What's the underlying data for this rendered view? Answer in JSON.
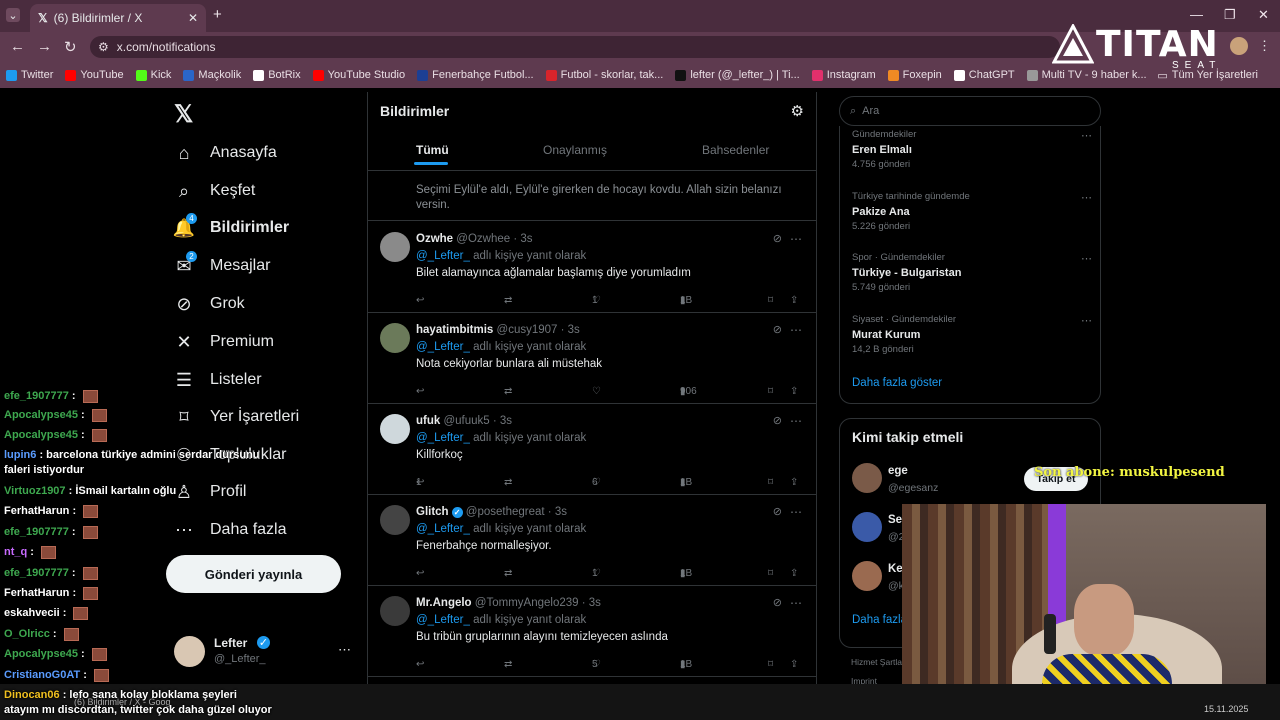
{
  "browser": {
    "tab_title": "(6) Bildirimler / X",
    "url": "x.com/notifications",
    "bookmarks": [
      {
        "label": "Twitter",
        "color": "#1d9bf0"
      },
      {
        "label": "YouTube",
        "color": "#ff0000"
      },
      {
        "label": "Kick",
        "color": "#53fc18"
      },
      {
        "label": "Maçkolik",
        "color": "#2a66c9"
      },
      {
        "label": "BotRix",
        "color": "#ffffff"
      },
      {
        "label": "YouTube Studio",
        "color": "#ff0000"
      },
      {
        "label": "Fenerbahçe Futbol...",
        "color": "#1c3f94"
      },
      {
        "label": "Futbol - skorlar, tak...",
        "color": "#d8242b"
      },
      {
        "label": "lefter (@_lefter_) | Ti...",
        "color": "#111111"
      },
      {
        "label": "Instagram",
        "color": "#e1306c"
      },
      {
        "label": "Foxepin",
        "color": "#f08a24"
      },
      {
        "label": "ChatGPT",
        "color": "#ffffff"
      },
      {
        "label": "Multi TV - 9 haber k...",
        "color": "#999999"
      }
    ],
    "all_bookmarks": "Tüm Yer İşaretleri"
  },
  "brand_overlay": {
    "titan": "TITAN",
    "seat": "SEAT"
  },
  "sidebar": {
    "items": [
      {
        "label": "Anasayfa",
        "icon": "⌂"
      },
      {
        "label": "Keşfet",
        "icon": "⌕"
      },
      {
        "label": "Bildirimler",
        "icon": "🔔",
        "badge": "4"
      },
      {
        "label": "Mesajlar",
        "icon": "✉",
        "badge": "2"
      },
      {
        "label": "Grok",
        "icon": "⊘"
      },
      {
        "label": "Premium",
        "icon": "✕"
      },
      {
        "label": "Listeler",
        "icon": "☰"
      },
      {
        "label": "Yer İşaretleri",
        "icon": "⌑"
      },
      {
        "label": "Topluluklar",
        "icon": "⚇"
      },
      {
        "label": "Profil",
        "icon": "♙"
      },
      {
        "label": "Daha fazla",
        "icon": "⋯"
      }
    ],
    "post_button": "Gönderi yayınla",
    "profile": {
      "name": "Lefter",
      "handle": "@_Lefter_"
    }
  },
  "chat": [
    {
      "user": "efe_1907777",
      "color": "#3ea84f",
      "text": "",
      "emote": true
    },
    {
      "user": "Apocalypse45",
      "color": "#3ea84f",
      "text": "",
      "emote": true
    },
    {
      "user": "Apocalypse45",
      "color": "#3ea84f",
      "text": "",
      "emote": true
    },
    {
      "user": "lupin6",
      "color": "#5a9cff",
      "text": "barcelona türkiye admini serdar dürsunu faleri istiyordur",
      "emote": false
    },
    {
      "user": "Virtuoz1907",
      "color": "#3ea84f",
      "text": "İSmail kartalın oğlu",
      "emote": false
    },
    {
      "user": "FerhatHarun",
      "color": "#ffffff",
      "text": "",
      "emote": true
    },
    {
      "user": "efe_1907777",
      "color": "#3ea84f",
      "text": "",
      "emote": true
    },
    {
      "user": "nt_q",
      "color": "#c86bff",
      "text": "",
      "emote": true
    },
    {
      "user": "efe_1907777",
      "color": "#3ea84f",
      "text": "",
      "emote": true
    },
    {
      "user": "FerhatHarun",
      "color": "#ffffff",
      "text": "",
      "emote": true
    },
    {
      "user": "eskahvecii",
      "color": "#ffffff",
      "text": "",
      "emote": true
    },
    {
      "user": "O_Olricc",
      "color": "#3ea84f",
      "text": "",
      "emote": true
    },
    {
      "user": "Apocalypse45",
      "color": "#3ea84f",
      "text": "",
      "emote": true
    },
    {
      "user": "CristianoG0AT",
      "color": "#5a9cff",
      "text": "",
      "emote": true
    },
    {
      "user": "Dinocan06",
      "color": "#f0c020",
      "text": "lefo sana kolay bloklama şeyleri atayım mı discordtan, twitter çok daha güzel oluyor",
      "emote": false
    }
  ],
  "main": {
    "title": "Bildirimler",
    "tabs": [
      "Tümü",
      "Onaylanmış",
      "Bahsedenler"
    ],
    "top_snippet": "Seçimi Eylül'e aldı, Eylül'e girerken de hocayı kovdu. Allah sizin belanızı versin.",
    "reply_prefix": "adlı kişiye yanıt olarak",
    "reply_mention": "@_Lefter_",
    "tweets": [
      {
        "name": "Ozwhe",
        "handle": "@Ozwhee · 3s",
        "text": "Bilet alamayınca ağlamalar başlamış diye yorumladım",
        "replies": "",
        "retweets": "",
        "likes": "1",
        "views": "1B",
        "avatar": "#8a8a8a"
      },
      {
        "name": "hayatimbitmis",
        "handle": "@cusy1907 · 3s",
        "text": "Nota cekiyorlar bunlara ali müstehak",
        "replies": "",
        "retweets": "",
        "likes": "",
        "views": "906",
        "avatar": "#6b7a5a"
      },
      {
        "name": "ufuk",
        "handle": "@ufuuk5 · 3s",
        "text": "Killforkoç",
        "replies": "1",
        "retweets": "",
        "likes": "6",
        "views": "1B",
        "avatar": "#cfd8dc"
      },
      {
        "name": "Glitch",
        "handle": "@posethegreat · 3s",
        "text": "Fenerbahçe normalleşiyor.",
        "replies": "",
        "retweets": "",
        "likes": "1",
        "views": "1B",
        "avatar": "#444444",
        "verified": true
      },
      {
        "name": "Mr.Angelo",
        "handle": "@TommyAngelo239 · 3s",
        "text": "Bu tribün gruplarının alayını temizleyecen aslında",
        "replies": "",
        "retweets": "",
        "likes": "5",
        "views": "1B",
        "avatar": "#3a3a3a"
      }
    ]
  },
  "right": {
    "search_placeholder": "Ara",
    "trends": [
      {
        "context": "Gündemdekiler",
        "name": "Eren Elmalı",
        "count": "4.756 gönderi"
      },
      {
        "context": "Türkiye tarihinde gündemde",
        "name": "Pakize Ana",
        "count": "5.226 gönderi"
      },
      {
        "context": "Spor · Gündemdekiler",
        "name": "Türkiye - Bulgaristan",
        "count": "5.749 gönderi"
      },
      {
        "context": "Siyaset · Gündemdekiler",
        "name": "Murat Kurum",
        "count": "14,2 B gönderi"
      }
    ],
    "show_more": "Daha fazla göster",
    "who_to_follow_title": "Kimi takip etmeli",
    "follow_users": [
      {
        "name": "ege",
        "handle": "@egesanz"
      },
      {
        "name": "Se",
        "handle": "@2"
      },
      {
        "name": "Ke",
        "handle": "@k"
      }
    ],
    "follow_button": "Takip et",
    "show_more_2": "Daha fazla",
    "footer": [
      "Hizmet Şartla",
      "Imprint"
    ]
  },
  "stream_overlay": {
    "subscriber": "Son abone: muskulpesend"
  },
  "taskbar": {
    "item": "(6) Bildirimler / X - Goog",
    "date": "15.11.2025"
  }
}
